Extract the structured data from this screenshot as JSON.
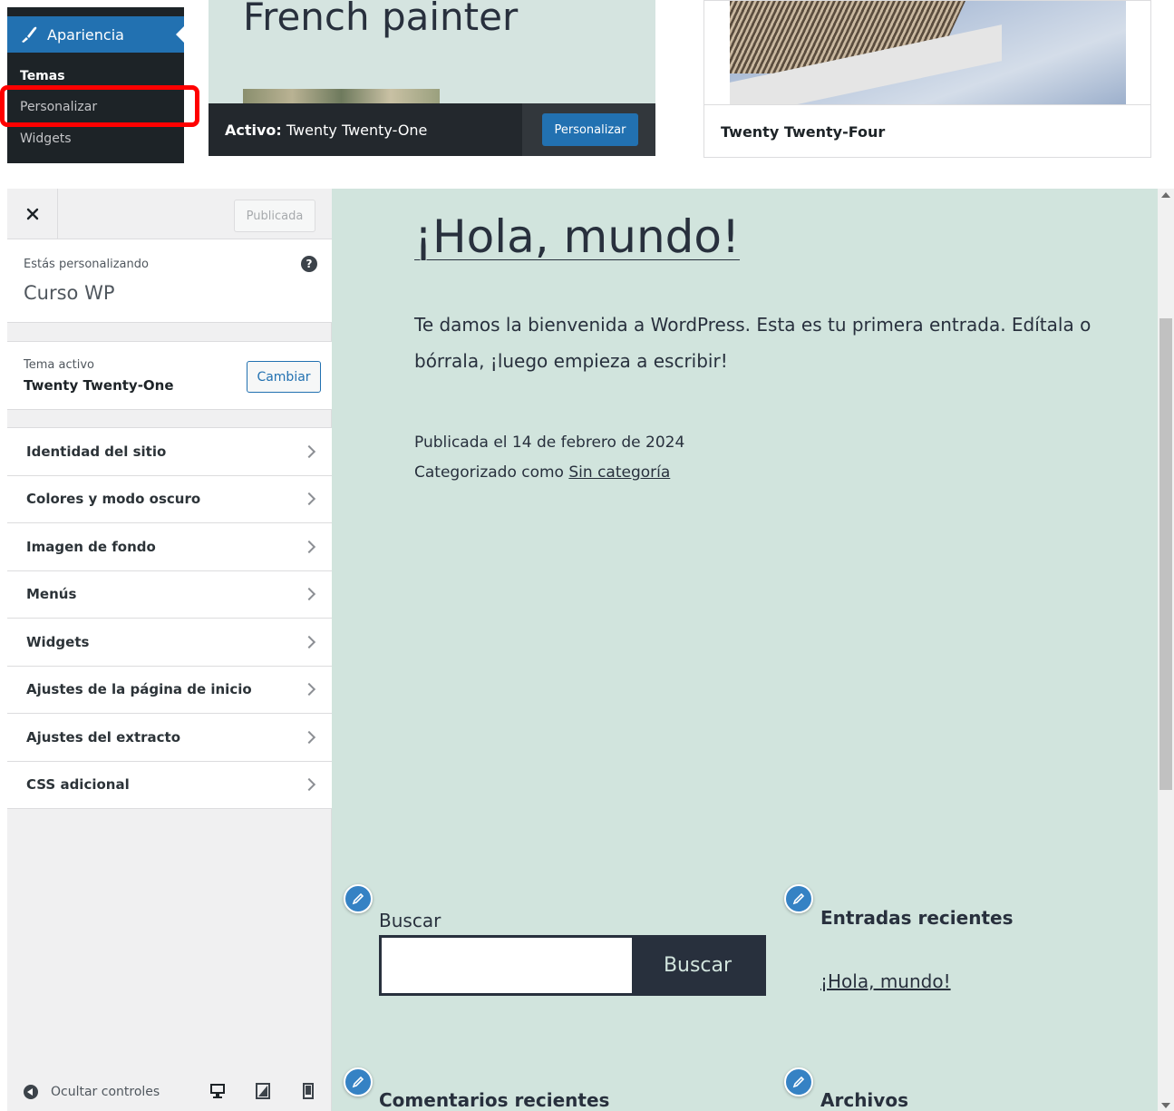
{
  "admin_menu": {
    "active_section": "Apariencia",
    "submenu": [
      "Temas",
      "Personalizar",
      "Widgets"
    ]
  },
  "themes": {
    "active_card": {
      "heading": "French painter",
      "active_prefix": "Activo:",
      "active_name": "Twenty Twenty-One",
      "customize_label": "Personalizar"
    },
    "other_card": {
      "name": "Twenty Twenty-Four"
    }
  },
  "customizer": {
    "close_icon": "close-icon",
    "publish_label": "Publicada",
    "customizing_label": "Estás personalizando",
    "site_title": "Curso WP",
    "help_icon": "?",
    "theme_label": "Tema activo",
    "theme_name": "Twenty Twenty-One",
    "change_label": "Cambiar",
    "panels": [
      "Identidad del sitio",
      "Colores y modo oscuro",
      "Imagen de fondo",
      "Menús",
      "Widgets",
      "Ajustes de la página de inicio",
      "Ajustes del extracto",
      "CSS adicional"
    ],
    "hide_controls_label": "Ocultar controles",
    "devices": [
      "desktop-icon",
      "tablet-icon",
      "mobile-icon"
    ]
  },
  "preview": {
    "post_title": "¡Hola, mundo!",
    "post_content": "Te damos la bienvenida a WordPress. Esta es tu primera entrada. Edítala o bórrala, ¡luego empieza a escribir!",
    "post_date": "Publicada el 14 de febrero de 2024",
    "categorized_prefix": "Categorizado como",
    "category_link": "Sin categoría",
    "search_label": "Buscar",
    "search_button": "Buscar",
    "recent_posts_title": "Entradas recientes",
    "recent_post_link": "¡Hola, mundo!",
    "recent_comments_title": "Comentarios recientes",
    "archives_title": "Archivos"
  },
  "colors": {
    "wp_blue": "#2271b1",
    "admin_dark": "#1d2327",
    "preview_bg": "#d1e4dd",
    "highlight": "#ff0000"
  }
}
